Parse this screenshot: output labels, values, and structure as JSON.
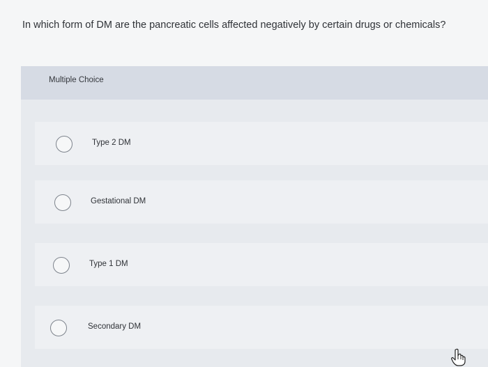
{
  "question": {
    "text": "In which form of DM are the pancreatic cells affected negatively by certain drugs or chemicals?"
  },
  "panel": {
    "title": "Multiple Choice"
  },
  "options": [
    {
      "label": "Type 2 DM"
    },
    {
      "label": "Gestational DM"
    },
    {
      "label": "Type 1 DM"
    },
    {
      "label": "Secondary DM"
    }
  ],
  "cursor": {
    "icon": "hand-pointer-icon"
  },
  "colors": {
    "background": "#f5f6f7",
    "header": "#d6dbe4",
    "option_bg": "#eef0f3",
    "radio_border": "#7d838c"
  }
}
